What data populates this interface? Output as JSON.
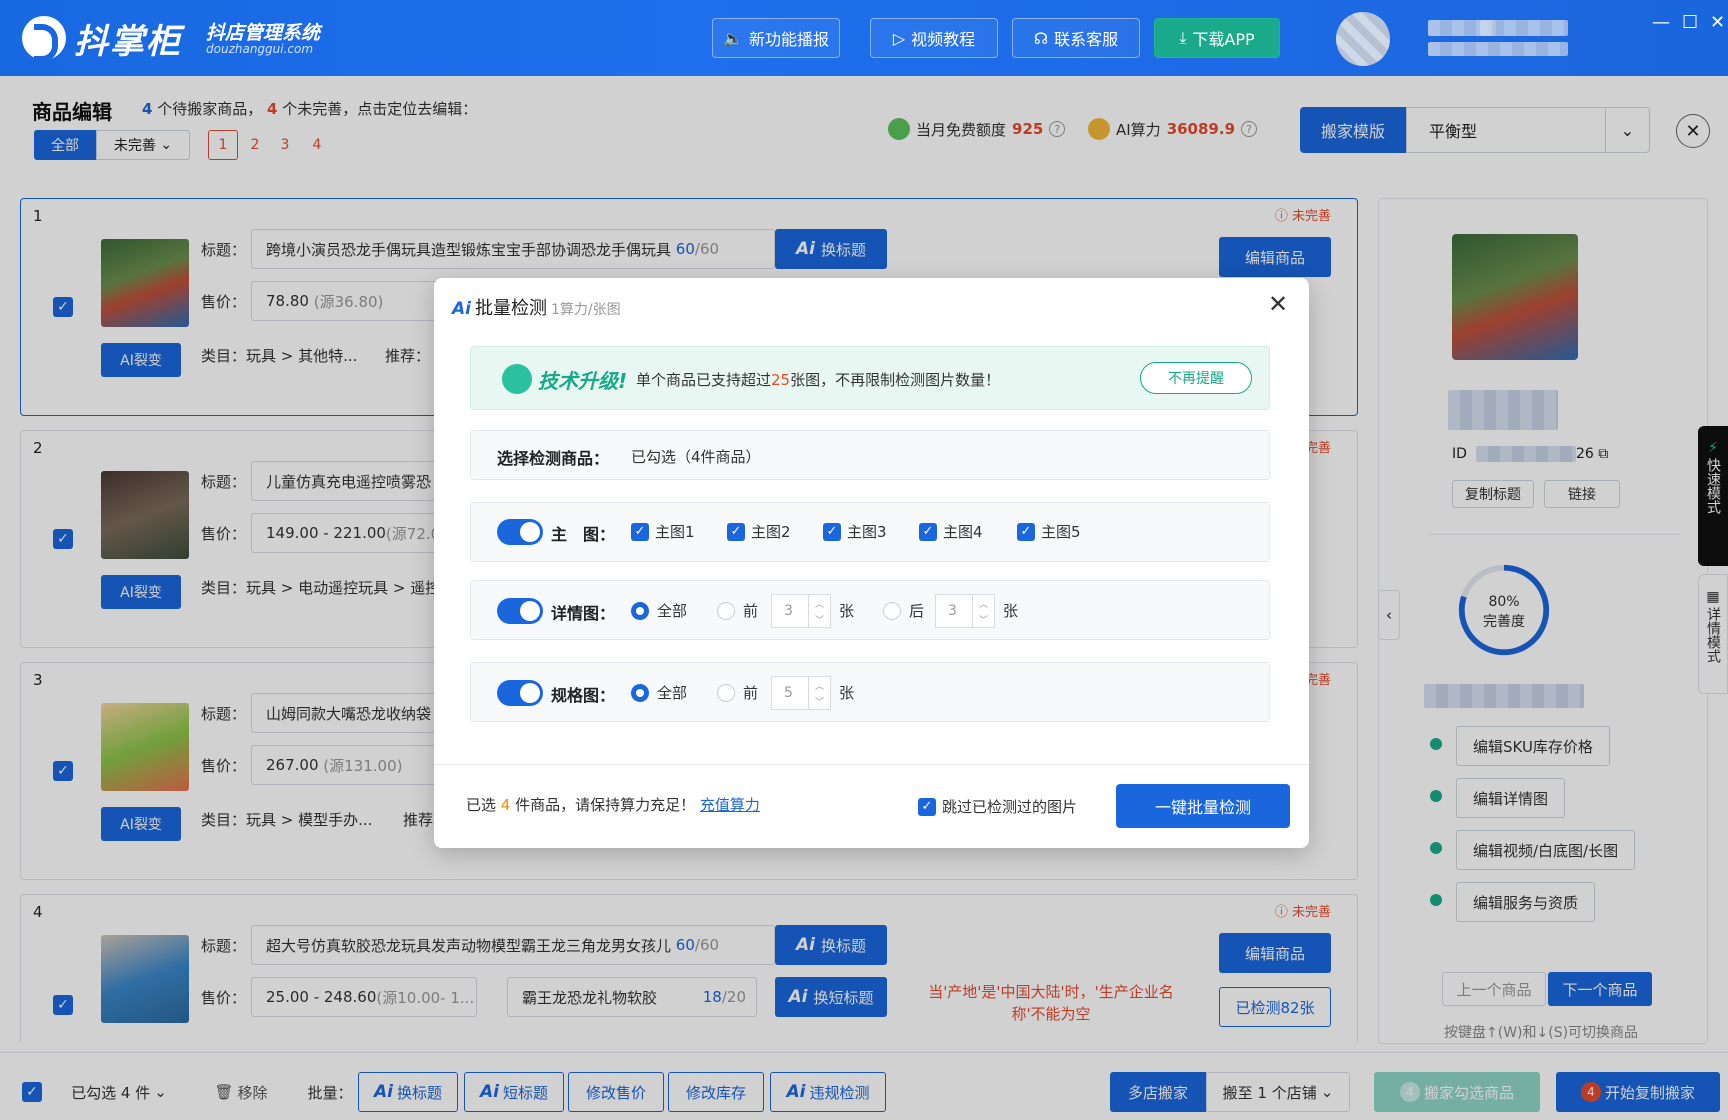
{
  "app": {
    "brand": "抖掌柜",
    "subtitle": "抖店管理系统",
    "domain": "douzhanggui.com"
  },
  "top_buttons": [
    {
      "label": "新功能播报"
    },
    {
      "label": "视频教程"
    },
    {
      "label": "联系客服"
    },
    {
      "label": "下载APP"
    }
  ],
  "window_controls": {
    "min": "—",
    "max": "☐",
    "close": "✕"
  },
  "header": {
    "title": "商品编辑",
    "count_pending": "4",
    "txt1": "个待搬家商品，",
    "count_incomplete": "4",
    "txt2": "个未完善，点击定位去编辑：",
    "filter_all": "全部",
    "filter_incomplete": "未完善",
    "pages": [
      "1",
      "2",
      "3",
      "4"
    ],
    "free_quota_label": "当月免费额度",
    "free_quota": "925",
    "ai_power_label": "AI算力",
    "ai_power": "36089.9",
    "template_btn": "搬家模版",
    "template_value": "平衡型"
  },
  "products": [
    {
      "idx": "1",
      "status": "未完善",
      "title": "跨境小演员恐龙手偶玩具造型锻炼宝宝手部协调恐龙手偶玩具",
      "title_count": "60",
      "title_max": "/60",
      "price": "78.80",
      "price_src": "(源36.80)",
      "category": "类目：玩具 > 其他特...",
      "recommend": "推荐：",
      "ai_title": "换标题",
      "edit": "编辑商品"
    },
    {
      "idx": "2",
      "status": "未完善",
      "title": "儿童仿真充电遥控喷雾恐",
      "price": "149.00 - 221.00",
      "price_src": "(源72.0",
      "category": "类目：玩具 > 电动遥控玩具 > 遥控"
    },
    {
      "idx": "3",
      "status": "未完善",
      "title": "山姆同款大嘴恐龙收纳袋",
      "price": "267.00",
      "price_src": "(源131.00)",
      "category": "类目：玩具 > 模型手办...",
      "recommend": "推荐"
    },
    {
      "idx": "4",
      "status": "未完善",
      "title": "超大号仿真软胶恐龙玩具发声动物模型霸王龙三角龙男女孩儿",
      "title_count": "60",
      "title_max": "/60",
      "price": "25.00 - 248.60",
      "price_src": "(源10.00- 1...",
      "short_title": "霸王龙恐龙礼物软胶",
      "short_count": "18",
      "short_max": "/20",
      "ai_title": "换标题",
      "ai_short": "换短标题",
      "edit": "编辑商品",
      "checked": "已检测82张",
      "error": "当'产地'是'中国大陆'时，'生产企业名称'不能为空"
    }
  ],
  "labels": {
    "title": "标题：",
    "price": "售价：",
    "ai_split": "AI裂变"
  },
  "right_panel": {
    "id_prefix": "ID",
    "id_suffix": "26",
    "copy_title": "复制标题",
    "copy_link": "链接",
    "completeness_pct": "80%",
    "completeness_label": "完善度",
    "completeness_value": 0.8,
    "actions": [
      "编辑SKU库存价格",
      "编辑详情图",
      "编辑视频/白底图/长图",
      "编辑服务与资质"
    ],
    "prev": "上一个商品",
    "next": "下一个商品",
    "kb_hint": "按键盘↑(W)和↓(S)可切换商品",
    "side_tabs": [
      {
        "text": "快速模式"
      },
      {
        "text": "详情模式"
      }
    ]
  },
  "bottom_bar": {
    "selected": "已勾选 4 件",
    "remove": "移除",
    "batch": "批量：",
    "btns": [
      "换标题",
      "短标题",
      "修改售价",
      "修改库存",
      "违规检测"
    ],
    "multi_store": "多店搬家",
    "move_to": "搬至 1 个店铺",
    "move_selected": "搬家勾选商品",
    "move_selected_count": "4",
    "start": "开始复制搬家",
    "start_count": "4"
  },
  "modal": {
    "title": "批量检测",
    "subtitle": "1算力/张图",
    "banner_head": "技术升级!",
    "banner_a": "单个商品已支持超过",
    "banner_num": "25",
    "banner_b": "张图，不再限制检测图片数量！",
    "dismiss": "不再提醒",
    "select_label": "选择检测商品：",
    "select_value": "已勾选（4件商品）",
    "main_label": "主　图：",
    "main_items": [
      "主图1",
      "主图2",
      "主图3",
      "主图4",
      "主图5"
    ],
    "detail_label": "详情图：",
    "all": "全部",
    "front": "前",
    "back": "后",
    "unit": "张",
    "detail_front_n": "3",
    "detail_back_n": "3",
    "spec_label": "规格图：",
    "spec_front_n": "5",
    "foot_a": "已选",
    "foot_n": "4",
    "foot_b": "件商品，请保持算力充足！",
    "recharge": "充值算力",
    "skip": "跳过已检测过的图片",
    "go": "一键批量检测"
  },
  "colors": {
    "primary": "#1a66dc",
    "danger": "#e64b2f",
    "success": "#17a98a"
  }
}
